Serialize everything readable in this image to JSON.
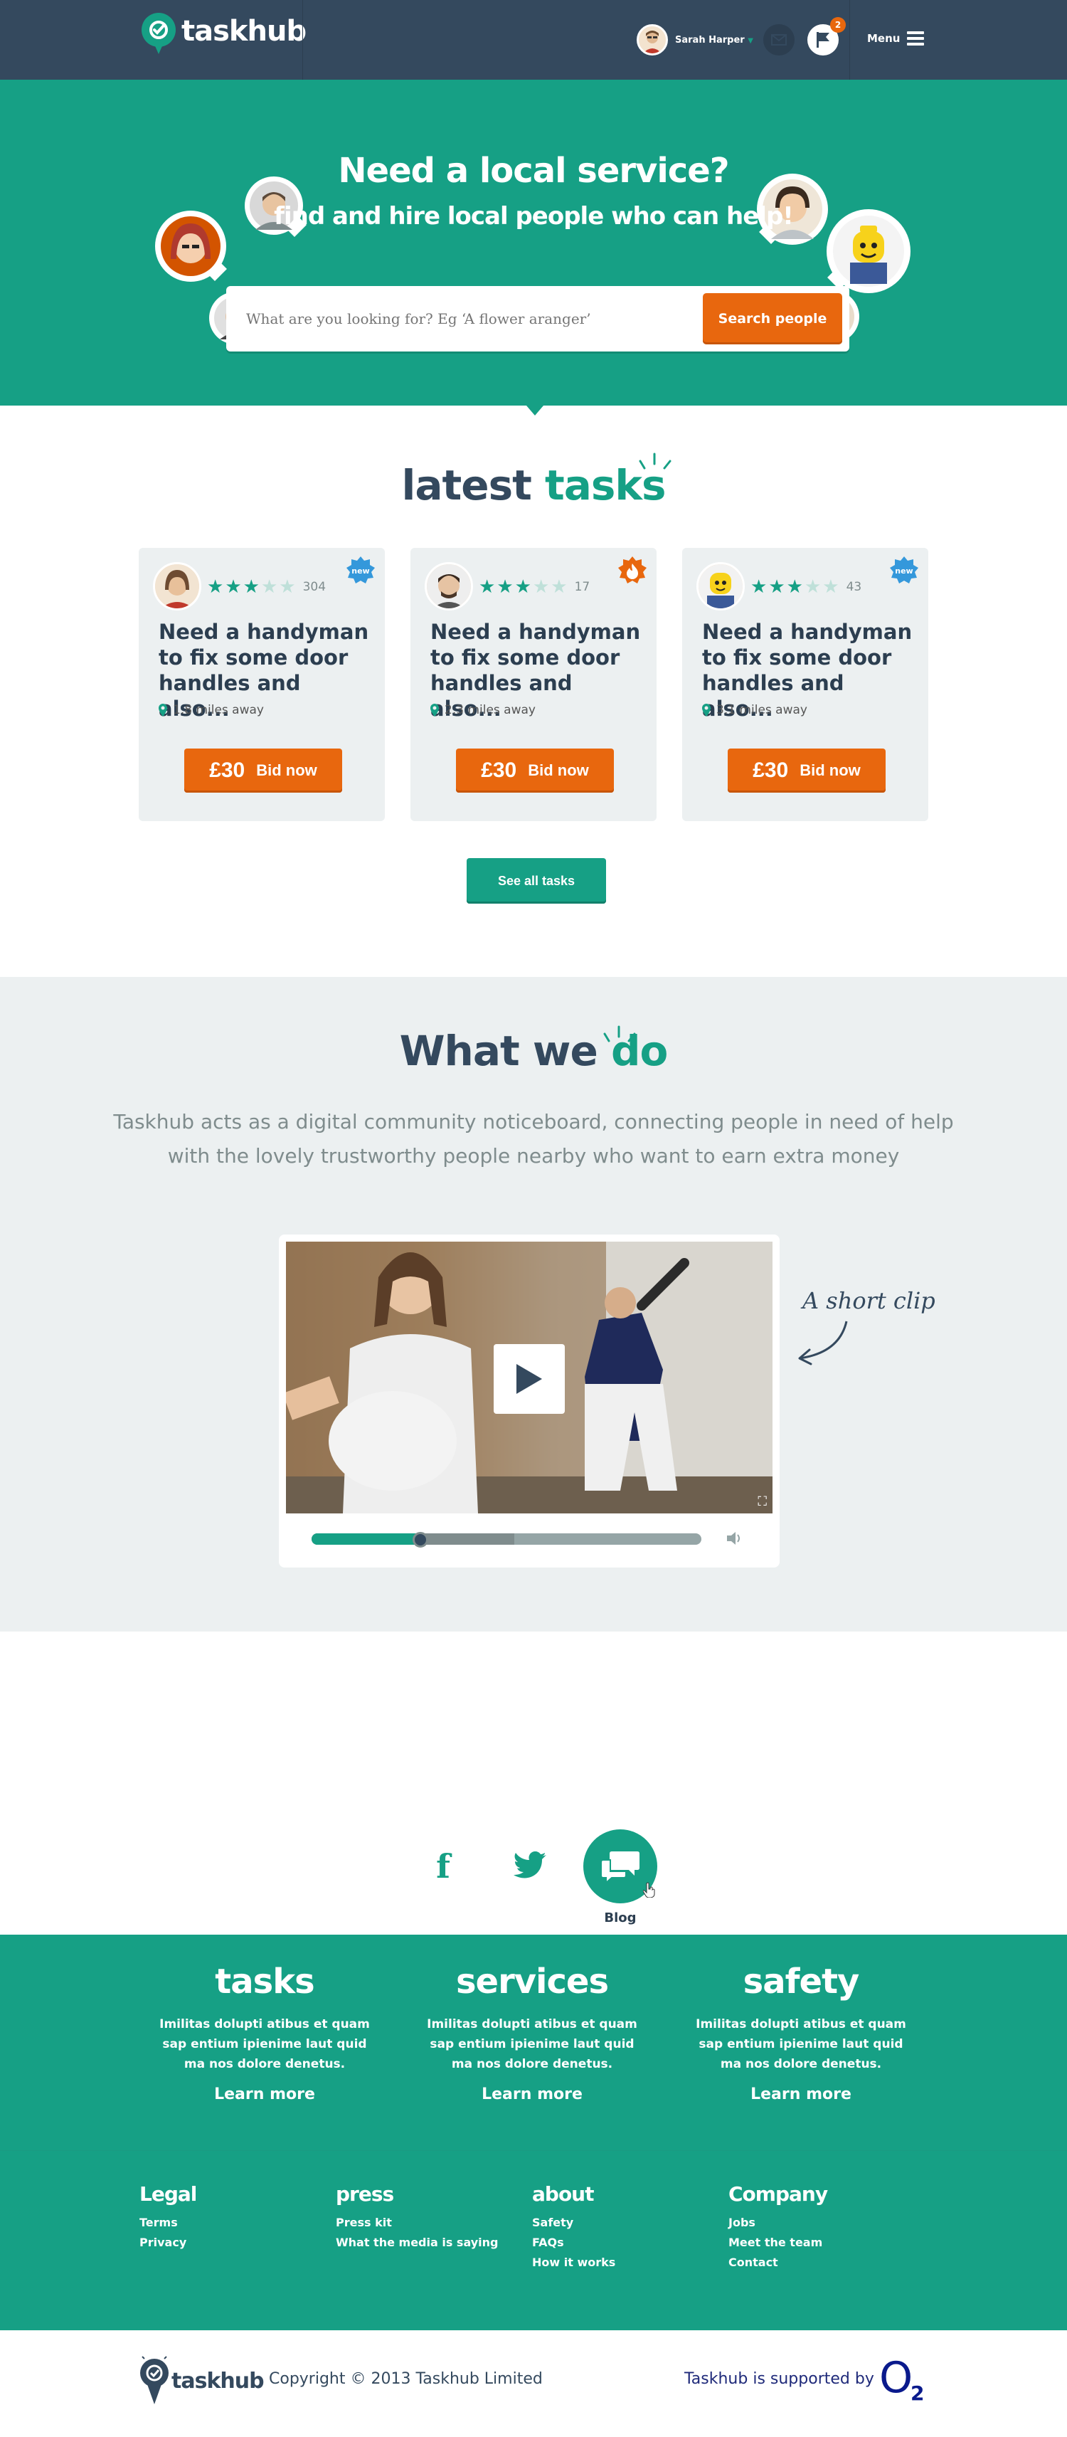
{
  "header": {
    "brand": "taskhub",
    "user_name": "Sarah Harper",
    "notifications_count": "2",
    "menu_label": "Menu"
  },
  "hero": {
    "title": "Need a local service?",
    "subtitle": "find and hire local people who can help!",
    "search_placeholder": "What are you looking for? Eg ‘A flower aranger’",
    "search_button": "Search people"
  },
  "latest": {
    "title_a": "latest",
    "title_b": "tasks",
    "cards": [
      {
        "rating": 3,
        "count": "304",
        "title": "Need a handyman to fix some door handles and also...",
        "distance": "1.8 miles away",
        "price": "£30",
        "bid_label": "Bid now",
        "badge": "new"
      },
      {
        "rating": 3,
        "count": "17",
        "title": "Need a handyman to fix some door handles and also...",
        "distance": "2.3 miles away",
        "price": "£30",
        "bid_label": "Bid now",
        "badge": "hot"
      },
      {
        "rating": 3,
        "count": "43",
        "title": "Need a handyman to fix some door handles and also...",
        "distance": "3.1 miles away",
        "price": "£30",
        "bid_label": "Bid now",
        "badge": "new"
      }
    ],
    "see_all": "See all tasks"
  },
  "whatwedo": {
    "title_a": "What we",
    "title_b": "do",
    "description": "Taskhub acts as a digital community noticeboard, connecting people in need of help with the lovely trustworthy people nearby who want to earn extra money",
    "clip_note": "A short clip",
    "video_progress": 0.28,
    "video_buffered": 0.52
  },
  "social": {
    "facebook_icon": "f",
    "blog_label": "Blog"
  },
  "footer": {
    "columns": [
      {
        "title": "tasks",
        "text": "Imilitas dolupti atibus et quam sap entium ipienime laut quid ma nos dolore denetus.",
        "link": "Learn more"
      },
      {
        "title": "services",
        "text": "Imilitas dolupti atibus et quam sap entium ipienime laut quid ma nos dolore denetus.",
        "link": "Learn more"
      },
      {
        "title": "safety",
        "text": "Imilitas dolupti atibus et quam sap entium ipienime laut quid ma nos dolore denetus.",
        "link": "Learn more"
      }
    ],
    "links": [
      {
        "title": "Legal",
        "items": [
          "Terms",
          "Privacy"
        ]
      },
      {
        "title": "press",
        "items": [
          "Press kit",
          "What the media is saying"
        ]
      },
      {
        "title": "about",
        "items": [
          "Safety",
          "FAQs",
          "How it works"
        ]
      },
      {
        "title": "Company",
        "items": [
          "Jobs",
          "Meet the team",
          "Contact"
        ]
      }
    ],
    "copyright": "Copyright © 2013 Taskhub Limited",
    "supported_by": "Taskhub is supported by",
    "o2_label": "O",
    "o2_sub": "2"
  },
  "colors": {
    "teal": "#16a085",
    "navy": "#34495e",
    "orange": "#e8670e",
    "light": "#ecf0f1",
    "badge_blue": "#3498db"
  }
}
